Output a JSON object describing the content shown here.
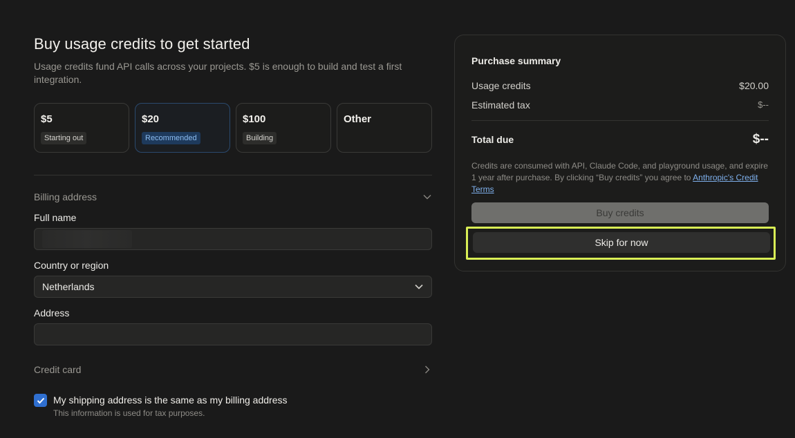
{
  "header": {
    "title": "Buy usage credits to get started",
    "subtitle": "Usage credits fund API calls across your projects. $5 is enough to build and test a first integration."
  },
  "tiers": [
    {
      "amount": "$5",
      "badge": "Starting out",
      "selected": false
    },
    {
      "amount": "$20",
      "badge": "Recommended",
      "selected": true
    },
    {
      "amount": "$100",
      "badge": "Building",
      "selected": false
    },
    {
      "amount": "Other",
      "badge": "",
      "selected": false
    }
  ],
  "billing": {
    "section_label": "Billing address",
    "full_name_label": "Full name",
    "full_name_value": "",
    "country_label": "Country or region",
    "country_value": "Netherlands",
    "address_label": "Address",
    "address_value": ""
  },
  "credit_card": {
    "label": "Credit card"
  },
  "shipping": {
    "checked": true,
    "label": "My shipping address is the same as my billing address",
    "sub": "This information is used for tax purposes."
  },
  "summary": {
    "title": "Purchase summary",
    "usage_label": "Usage credits",
    "usage_value": "$20.00",
    "tax_label": "Estimated tax",
    "tax_value": "$--",
    "total_label": "Total due",
    "total_value": "$--",
    "terms_text": "Credits are consumed with API, Claude Code, and playground usage, and expire 1 year after purchase. By clicking “Buy credits” you agree to",
    "terms_link": "Anthropic's Credit Terms",
    "buy_label": "Buy credits",
    "skip_label": "Skip for now"
  },
  "colors": {
    "highlight": "#d9ef55",
    "accent_blue": "#2f6fd0",
    "link": "#7fb1ee"
  }
}
